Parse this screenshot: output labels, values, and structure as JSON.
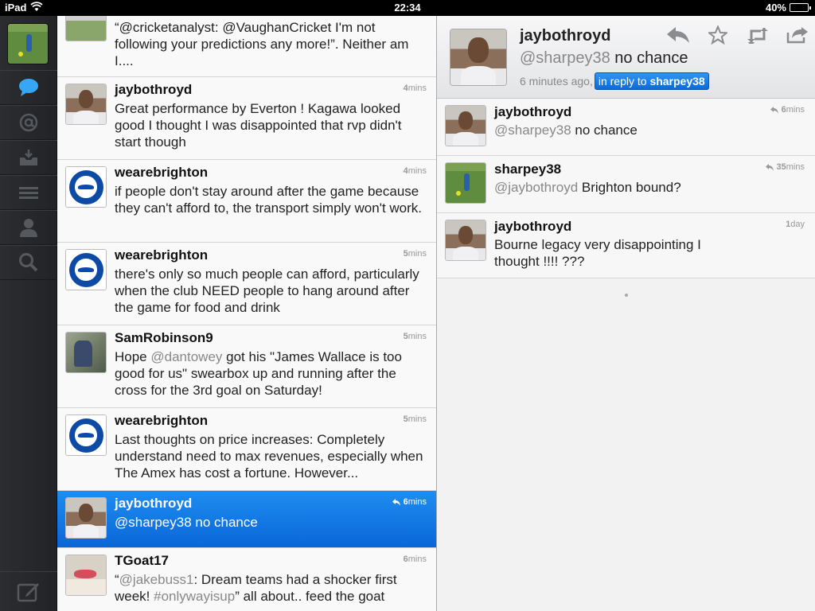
{
  "status_bar": {
    "carrier": "iPad",
    "time": "22:34",
    "battery": "40%",
    "battery_level": 0.4
  },
  "sidebar": {
    "items": [
      {
        "icon": "speech-bubble-icon",
        "active": true
      },
      {
        "icon": "at-sign-icon"
      },
      {
        "icon": "inbox-tray-icon"
      },
      {
        "icon": "list-lines-icon"
      },
      {
        "icon": "person-icon"
      },
      {
        "icon": "search-icon"
      }
    ],
    "compose_icon": "compose-icon"
  },
  "timeline": {
    "tweets": [
      {
        "name": "",
        "mention": "@cricketanalyst",
        "text_pre": "“",
        "mention2": "@VaughanCricket",
        "text": "“@cricketanalyst: @VaughanCricket I'm not following your predictions any more!”. Neither am I....",
        "time_num": "",
        "time_unit": ""
      },
      {
        "name": "jaybothroyd",
        "text": "Great performance by Everton ! Kagawa looked good I thought I was disappointed that rvp didn't start though",
        "time_num": "4",
        "time_unit": "mins"
      },
      {
        "name": "wearebrighton",
        "text": "if people don't stay around after the game because they can't afford to, the transport simply won't work.",
        "time_num": "4",
        "time_unit": "mins"
      },
      {
        "name": "wearebrighton",
        "text": "there's only so much people can afford, particularly when the club NEED people to hang around after the game for food and drink",
        "time_num": "5",
        "time_unit": "mins"
      },
      {
        "name": "SamRobinson9",
        "text_pre": "Hope ",
        "mention": "@dantowey",
        "text_post": " got his \"James Wallace is too good for us\" swearbox up and running after the cross for the 3rd goal on Saturday!",
        "time_num": "5",
        "time_unit": "mins"
      },
      {
        "name": "wearebrighton",
        "text": "Last thoughts on price increases: Completely understand need to max revenues, especially when The Amex has cost a fortune. However...",
        "time_num": "5",
        "time_unit": "mins"
      },
      {
        "name": "jaybothroyd",
        "mention": "@sharpey38",
        "text_post": " no chance",
        "time_num": "6",
        "time_unit": "mins"
      },
      {
        "name": "TGoat17",
        "text_pre": "“",
        "mention": "@jakebuss1",
        "text_mid": ": Dream teams had a shocker first week! ",
        "mention2": "#onlywayisup",
        "text_post": "” all about.. feed the goat",
        "time_num": "6",
        "time_unit": "mins"
      }
    ]
  },
  "detail": {
    "name": "jaybothroyd",
    "mention": "@sharpey38",
    "text": " no chance",
    "meta_time": "6 minutes ago,",
    "reply_label": "in reply to",
    "reply_user": "sharpey38",
    "actions": [
      "reply-arrow-icon",
      "star-icon",
      "retweet-icon",
      "share-icon"
    ],
    "conversation": [
      {
        "name": "jaybothroyd",
        "mention": "@sharpey38",
        "text": " no chance",
        "time_num": "6",
        "time_unit": "mins"
      },
      {
        "name": "sharpey38",
        "mention": "@jaybothroyd",
        "text": " Brighton bound?",
        "time_num": "35",
        "time_unit": "mins"
      },
      {
        "name": "jaybothroyd",
        "text": "Bourne legacy very disappointing I thought !!!! ???",
        "time_num": "1",
        "time_unit": "day"
      }
    ]
  }
}
